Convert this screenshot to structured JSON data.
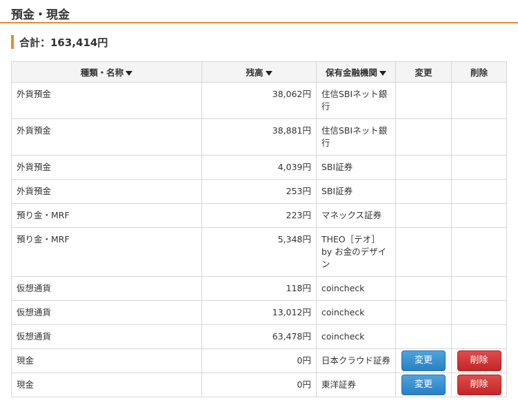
{
  "header": {
    "title": "預金・現金"
  },
  "total": {
    "label": "合計：163,414円"
  },
  "table": {
    "columns": [
      "種類・名称",
      "残高",
      "保有金融機関",
      "変更",
      "削除"
    ],
    "button_change": "変更",
    "button_delete": "削除",
    "rows": [
      {
        "type": "外貨預金",
        "balance": "38,062円",
        "institution": "住信SBIネット銀行",
        "editable": false
      },
      {
        "type": "外貨預金",
        "balance": "38,881円",
        "institution": "住信SBIネット銀行",
        "editable": false
      },
      {
        "type": "外貨預金",
        "balance": "4,039円",
        "institution": "SBI証券",
        "editable": false
      },
      {
        "type": "外貨預金",
        "balance": "253円",
        "institution": "SBI証券",
        "editable": false
      },
      {
        "type": "預り金・MRF",
        "balance": "223円",
        "institution": "マネックス証券",
        "editable": false
      },
      {
        "type": "預り金・MRF",
        "balance": "5,348円",
        "institution": "THEO［テオ］by お金のデザイン",
        "editable": false
      },
      {
        "type": "仮想通貨",
        "balance": "118円",
        "institution": "coincheck",
        "editable": false
      },
      {
        "type": "仮想通貨",
        "balance": "13,012円",
        "institution": "coincheck",
        "editable": false
      },
      {
        "type": "仮想通貨",
        "balance": "63,478円",
        "institution": "coincheck",
        "editable": false
      },
      {
        "type": "現金",
        "balance": "0円",
        "institution": "日本クラウド証券",
        "editable": true
      },
      {
        "type": "現金",
        "balance": "0円",
        "institution": "東洋証券",
        "editable": true
      }
    ]
  }
}
